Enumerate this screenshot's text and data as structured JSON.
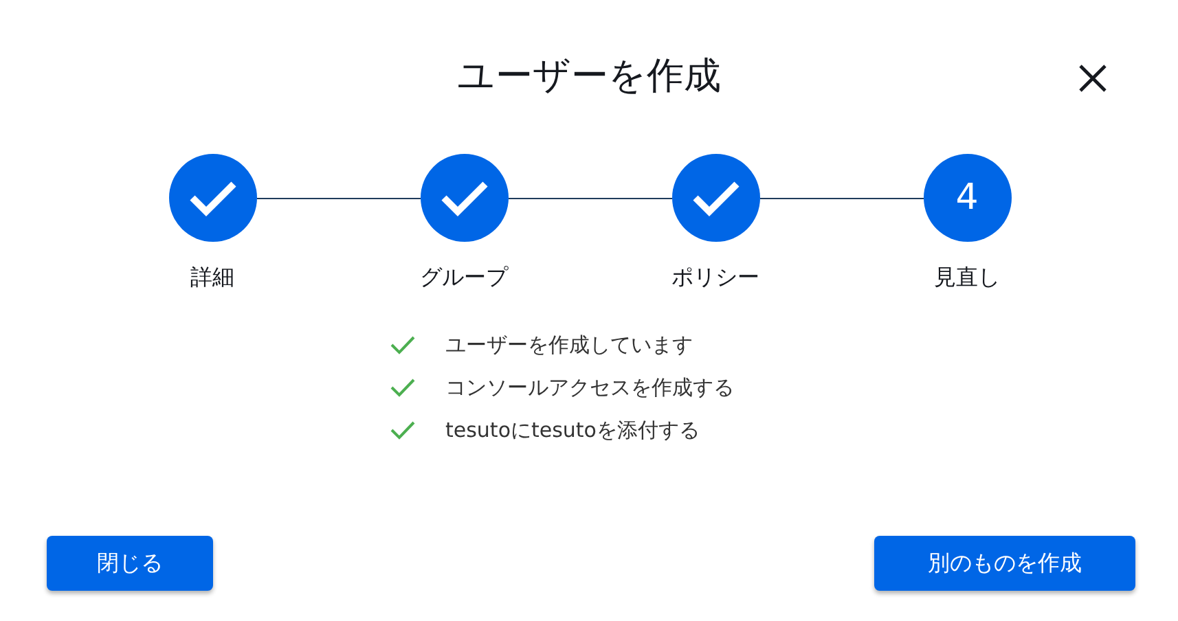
{
  "dialog": {
    "title": "ユーザーを作成"
  },
  "steps": [
    {
      "label": "詳細",
      "completed": true
    },
    {
      "label": "グループ",
      "completed": true
    },
    {
      "label": "ポリシー",
      "completed": true
    },
    {
      "label": "見直し",
      "number": "4",
      "completed": false
    }
  ],
  "results": [
    {
      "text": "ユーザーを作成しています",
      "done": true
    },
    {
      "text": "コンソールアクセスを作成する",
      "done": true
    },
    {
      "text": "tesutoにtesutoを添付する",
      "done": true
    }
  ],
  "buttons": [
    {
      "label": "閉じる"
    },
    {
      "label": "別のものを作成"
    }
  ]
}
